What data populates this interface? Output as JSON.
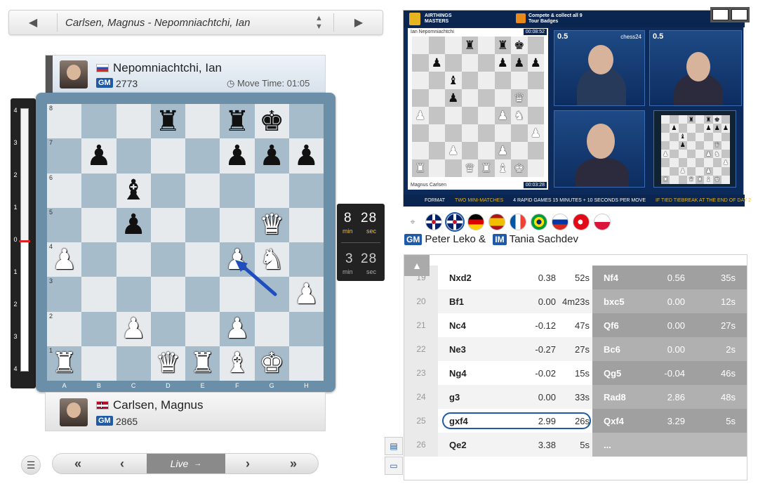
{
  "game": {
    "title": "Carlsen, Magnus - Nepomniachtchi, Ian"
  },
  "top_player": {
    "name": "Nepomniachtchi, Ian",
    "title": "GM",
    "rating": "2773",
    "move_time": "Move Time: 01:05"
  },
  "bottom_player": {
    "name": "Carlsen, Magnus",
    "title": "GM",
    "rating": "2865"
  },
  "eval_marks": [
    "4",
    "3",
    "2",
    "1",
    "0",
    "1",
    "2",
    "3",
    "4"
  ],
  "clock": {
    "top_min": "8",
    "top_sec": "28",
    "bot_min": "3",
    "bot_sec": "28",
    "min_label": "min",
    "sec_label": "sec"
  },
  "board": {
    "files": [
      "A",
      "B",
      "C",
      "D",
      "E",
      "F",
      "G",
      "H"
    ],
    "ranks": [
      "8",
      "7",
      "6",
      "5",
      "4",
      "3",
      "2",
      "1"
    ],
    "pieces": [
      [
        "",
        "",
        "",
        "br",
        "",
        "br",
        "bk",
        ""
      ],
      [
        "",
        "bp",
        "",
        "",
        "",
        "bp",
        "bp",
        "bp"
      ],
      [
        "",
        "",
        "bb",
        "",
        "",
        "",
        "",
        ""
      ],
      [
        "",
        "",
        "bp",
        "",
        "",
        "",
        "wq",
        ""
      ],
      [
        "wp",
        "",
        "",
        "",
        "",
        "wp",
        "wn",
        ""
      ],
      [
        "",
        "",
        "",
        "",
        "",
        "",
        "",
        "wp"
      ],
      [
        "",
        "",
        "wp",
        "",
        "",
        "wp",
        "",
        ""
      ],
      [
        "wr",
        "",
        "",
        "wq",
        "wr",
        "wb",
        "wk",
        ""
      ]
    ],
    "glyphs": {
      "k": "♚",
      "q": "♛",
      "r": "♜",
      "b": "♝",
      "n": "♞",
      "p": "♟"
    }
  },
  "nav": {
    "live_label": "Live",
    "first": "«",
    "prev": "‹",
    "next": "›",
    "last": "»"
  },
  "video": {
    "event": "AIRTHINGS MASTERS",
    "promo": "Compete & collect all 9 Tour Badges",
    "top_name": "Ian Nepomniachtchi",
    "top_clock": "00:08:52",
    "bot_name": "Magnus Carlsen",
    "bot_clock": "00:03:28",
    "score_left": "0.5",
    "score_right": "0.5",
    "sponsor": "chess24",
    "ticker": [
      "FORMAT",
      "TWO MINI-MATCHES",
      "4 RAPID GAMES 15 MINUTES + 10 SECONDS PER MOVE",
      "IF TIED TIEBREAK AT THE END OF DAY 2"
    ]
  },
  "commentary": {
    "lead_title": "GM",
    "lead_name": "Peter Leko &",
    "second_title": "IM",
    "second_name": "Tania Sachdev"
  },
  "languages": [
    "gb",
    "gb",
    "de",
    "es",
    "fr",
    "br",
    "ru",
    "tr",
    "pl"
  ],
  "moves": [
    {
      "n": "19",
      "w": "Nxd2",
      "we": "0.38",
      "wt": "52s",
      "b": "Nf4",
      "be": "0.56",
      "bt": "35s"
    },
    {
      "n": "20",
      "w": "Bf1",
      "we": "0.00",
      "wt": "4m23s",
      "b": "bxc5",
      "be": "0.00",
      "bt": "12s"
    },
    {
      "n": "21",
      "w": "Nc4",
      "we": "-0.12",
      "wt": "47s",
      "b": "Qf6",
      "be": "0.00",
      "bt": "27s"
    },
    {
      "n": "22",
      "w": "Ne3",
      "we": "-0.27",
      "wt": "27s",
      "b": "Bc6",
      "be": "0.00",
      "bt": "2s"
    },
    {
      "n": "23",
      "w": "Ng4",
      "we": "-0.02",
      "wt": "15s",
      "b": "Qg5",
      "be": "-0.04",
      "bt": "46s"
    },
    {
      "n": "24",
      "w": "g3",
      "we": "0.00",
      "wt": "33s",
      "b": "Rad8",
      "be": "2.86",
      "bt": "48s"
    },
    {
      "n": "25",
      "w": "gxf4",
      "we": "2.99",
      "wt": "26s",
      "b": "Qxf4",
      "be": "3.29",
      "bt": "5s"
    },
    {
      "n": "26",
      "w": "Qe2",
      "we": "3.38",
      "wt": "5s",
      "b": "...",
      "be": "",
      "bt": ""
    }
  ],
  "colors": {
    "accent": "#1e5aa8",
    "board_light": "#e6eaed",
    "board_dark": "#a7bccb",
    "arrow": "#1f4fbf"
  }
}
